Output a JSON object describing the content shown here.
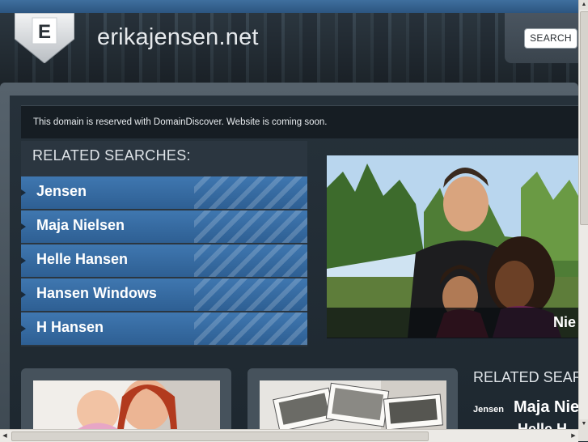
{
  "header": {
    "logo_letter": "E",
    "site_title": "erikajensen.net",
    "search_label": "SEARCH"
  },
  "notice": {
    "text": "This domain is reserved with DomainDiscover. Website is coming soon."
  },
  "related": {
    "heading": "RELATED SEARCHES:",
    "items": [
      "Jensen",
      "Maja Nielsen",
      "Helle Hansen",
      "Hansen Windows",
      "H Hansen"
    ]
  },
  "featured": {
    "caption": "Nie"
  },
  "related2": {
    "heading": "RELATED SEAR",
    "small": "Jensen",
    "big": "Maja Nie",
    "big2": "Helle H"
  },
  "colors": {
    "accent_blue": "#3f77b0",
    "background_dark": "#1f2a33",
    "top_stripe": "#3f6f9e"
  },
  "icons": [
    "logo-shield-icon",
    "list-bullet-icon",
    "scroll-arrow-icon"
  ]
}
